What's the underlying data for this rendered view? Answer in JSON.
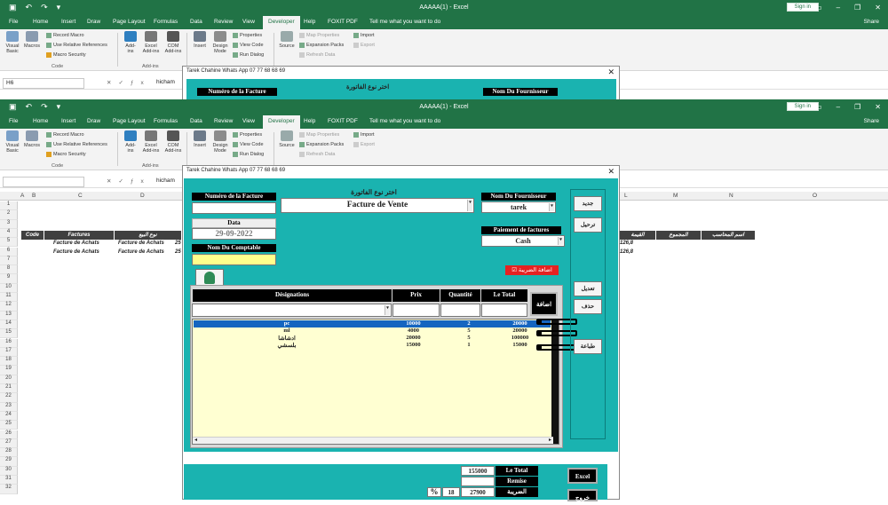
{
  "app": {
    "title": "AAAAA(1) - Excel",
    "sign_in": "Sign in",
    "share": "Share",
    "tabs": [
      "File",
      "Home",
      "Insert",
      "Draw",
      "Page Layout",
      "Formulas",
      "Data",
      "Review",
      "View",
      "Developer",
      "Help",
      "FOXIT PDF"
    ],
    "tell_me": "Tell me what you want to do"
  },
  "ribbon": {
    "code_group": "Code",
    "addins_group": "Add-ins",
    "visual_basic": "Visual Basic",
    "macros": "Macros",
    "record_macro": "Record Macro",
    "use_relative": "Use Relative References",
    "macro_security": "Macro Security",
    "addins": "Add-ins",
    "excel_addins": "Excel Add-ins",
    "com_addins": "COM Add-ins",
    "insert": "Insert",
    "design_mode": "Design Mode",
    "properties": "Properties",
    "view_code": "View Code",
    "run_dialog": "Run Dialog",
    "source": "Source",
    "map_properties": "Map Properties",
    "expansion_packs": "Expansion Packs",
    "refresh_data": "Refresh Data",
    "import": "Import",
    "export": "Export"
  },
  "formula_bar": {
    "name_box_top": "H6",
    "name_box": "",
    "content": "hicham"
  },
  "columns": [
    "A",
    "B",
    "C",
    "D",
    "L",
    "M",
    "N",
    "O"
  ],
  "rows": [
    "1",
    "2",
    "3",
    "4",
    "5",
    "6",
    "7",
    "8",
    "9",
    "10",
    "11",
    "12",
    "13",
    "14",
    "15",
    "16",
    "17",
    "18",
    "19",
    "20",
    "21",
    "22",
    "23",
    "24",
    "25",
    "26",
    "27",
    "28",
    "29",
    "30",
    "31",
    "32"
  ],
  "sheet": {
    "headers": {
      "code": "Code",
      "factures": "Factures",
      "type": "نوع البيع",
      "total_partial": "القيمة",
      "majmou": "المجموع",
      "accountant": "اسم المحاسب"
    },
    "rows": [
      {
        "c": "Facture de Achats",
        "d": "Facture de Achats",
        "e": "25",
        "l": "126,8"
      },
      {
        "c": "Facture de Achats",
        "d": "Facture de Achats",
        "e": "25",
        "l": "126,8"
      }
    ]
  },
  "dialog": {
    "title": "Tarek Chahine Whats App 07 77 68 68 69",
    "invoice_number_label": "Numéro de la Facture",
    "invoice_number_value": "",
    "invoice_type_label": "اختر نوع الفاتورة",
    "invoice_type_value": "Facture de Vente",
    "supplier_label": "Nom Du Fournisseur",
    "supplier_value": "tarek",
    "date_label": "Data",
    "date_value": "29-09-2022",
    "payment_label": "Paiement de factures",
    "payment_value": "Cash",
    "accountant_label": "Nom Du Comptable",
    "accountant_value": "",
    "tax_checkbox_label": "اضافة الضريبة",
    "btn_new": "جديد",
    "btn_save": "ترحيل",
    "btn_edit": "تعديل",
    "btn_delete": "حذف",
    "btn_add": "اضافة",
    "btn_print": "طباعة",
    "btn_excel": "Excel",
    "btn_exit": "خروج",
    "grid_headers": {
      "designation": "Désignations",
      "price": "Prix",
      "quantity": "Quantité",
      "total": "Le Total"
    },
    "items": [
      {
        "designation": "pc",
        "price": "10000",
        "qty": "2",
        "total": "20000"
      },
      {
        "designation": "ml",
        "price": "4000",
        "qty": "5",
        "total": "20000"
      },
      {
        "designation": "ادشاشا",
        "price": "20000",
        "qty": "5",
        "total": "100000"
      },
      {
        "designation": "بلسشي",
        "price": "15000",
        "qty": "1",
        "total": "15000"
      }
    ],
    "summary": {
      "total_label": "Le Total",
      "total_value": "155000",
      "remise_label": "Remise",
      "remise_value": "",
      "tax_label": "الضريبة",
      "tax_percent_sign": "%",
      "tax_percent": "18",
      "tax_value": "27900"
    }
  }
}
